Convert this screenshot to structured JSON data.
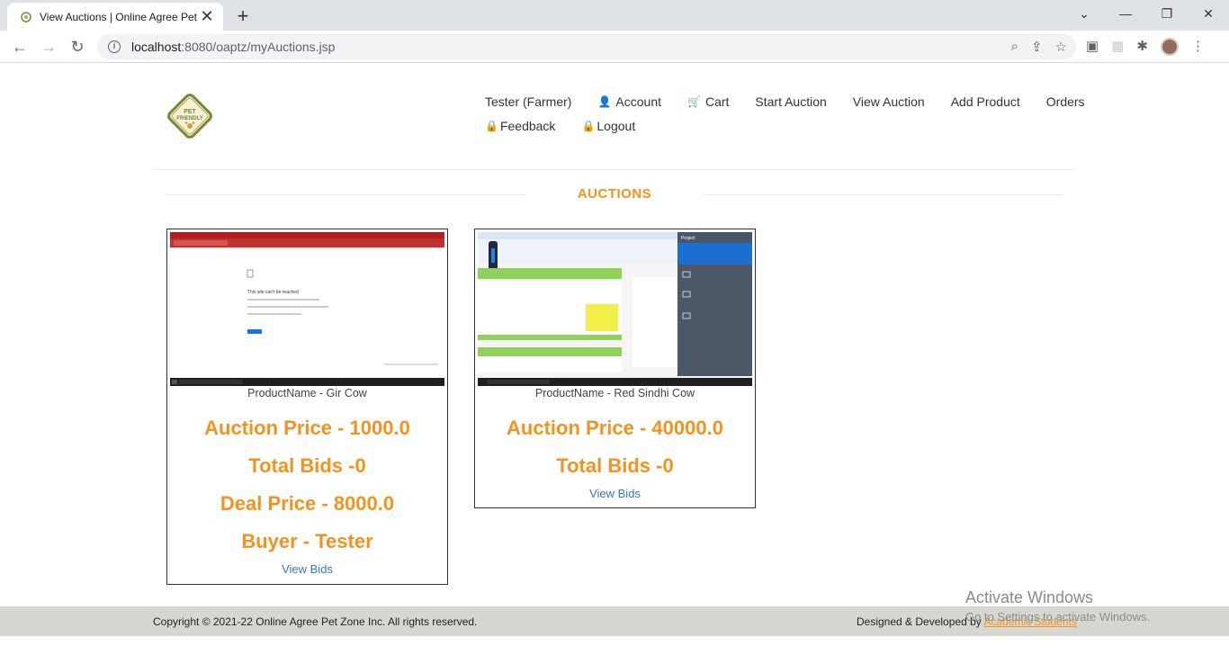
{
  "browser": {
    "tab_title": "View Auctions | Online Agree Pet",
    "tab_close": "✕",
    "new_tab": "+",
    "url_host": "localhost",
    "url_path": ":8080/oaptz/myAuctions.jsp",
    "win_min": "—",
    "win_restore": "❐",
    "win_close": "✕",
    "win_dropdown": "⌄"
  },
  "logo": {
    "line1": "PET",
    "line2": "FRIENDLY"
  },
  "nav": {
    "row1": [
      "Tester (Farmer)",
      "Account",
      "Cart",
      "Start Auction",
      "View Auction",
      "Add Product",
      "Orders"
    ],
    "row2": [
      "Feedback",
      "Logout"
    ]
  },
  "section_title": "AUCTIONS",
  "auctions": [
    {
      "product": "ProductName - Gir Cow",
      "auction_price": "Auction Price - 1000.0",
      "total_bids": "Total Bids -0",
      "deal_price": "Deal Price - 8000.0",
      "buyer": "Buyer - Tester",
      "view_bids": "View Bids",
      "img_heading": "This site can't be reached"
    },
    {
      "product": "ProductName - Red Sindhi Cow",
      "auction_price": "Auction Price - 40000.0",
      "total_bids": "Total Bids -0",
      "view_bids": "View Bids",
      "img_heading": "Project"
    }
  ],
  "footer": {
    "copyright": "Copyright © 2021-22 Online Agree Pet Zone Inc. All rights reserved.",
    "designed_by": "Designed & Developed by ",
    "designer": "Academic Students"
  },
  "watermark": {
    "line1": "Activate Windows",
    "line2": "Go to Settings to activate Windows."
  },
  "colors": {
    "accent": "#f4921d",
    "link": "#3579b8",
    "footer_bg": "#d7d7d1"
  }
}
